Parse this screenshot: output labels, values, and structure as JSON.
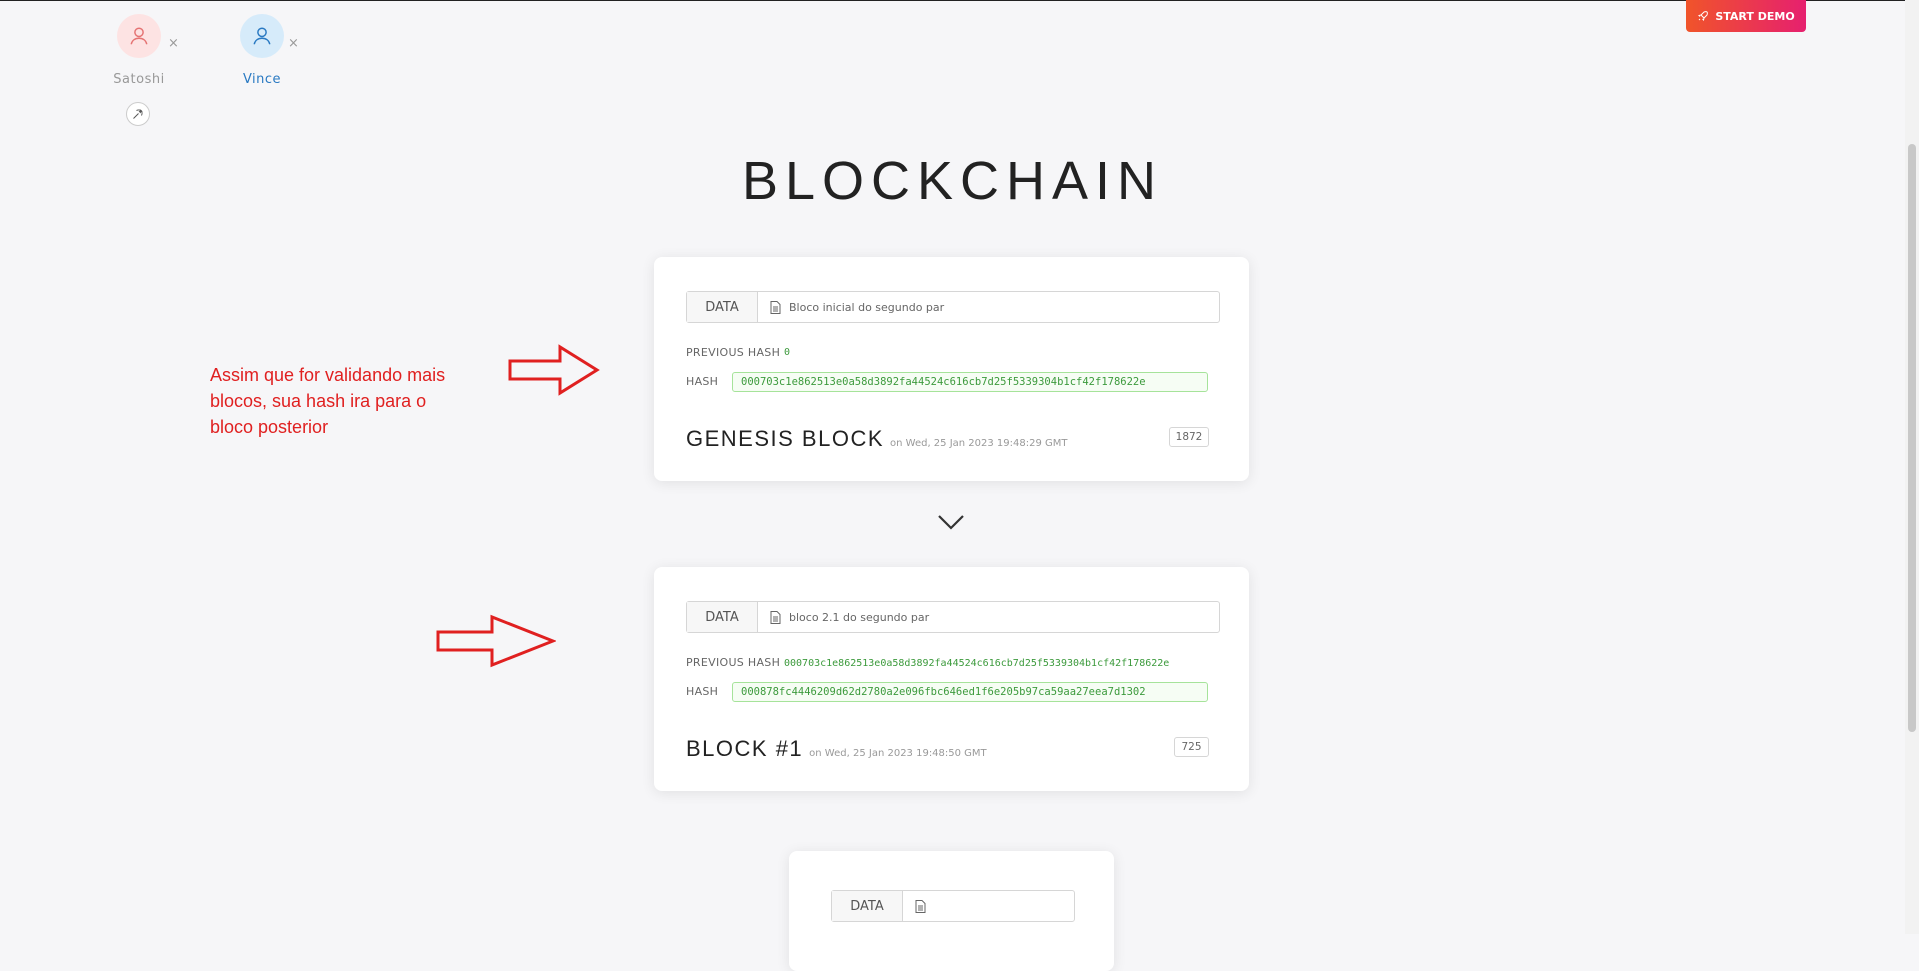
{
  "users": [
    {
      "name": "Satoshi",
      "avatar_icon": "user-icon",
      "color": "#e57373",
      "remove": "×"
    },
    {
      "name": "Vince",
      "avatar_icon": "user-icon",
      "color": "#2979c2",
      "remove": "×"
    }
  ],
  "demo_button": {
    "label": "START DEMO",
    "icon": "rocket-icon"
  },
  "page_title": "BLOCKCHAIN",
  "annotation": "Assim que for validando mais blocos, sua hash ira para o bloco posterior",
  "labels": {
    "data": "DATA",
    "previous_hash": "PREVIOUS HASH",
    "hash": "HASH"
  },
  "blocks": [
    {
      "data": "Bloco inicial do segundo par",
      "previous_hash": "0",
      "hash": "000703c1e862513e0a58d3892fa44524c616cb7d25f5339304b1cf42f178622e",
      "title": "GENESIS BLOCK",
      "timestamp": "on Wed, 25 Jan 2023 19:48:29 GMT",
      "nonce": "1872"
    },
    {
      "data": "bloco 2.1 do segundo par",
      "previous_hash": "000703c1e862513e0a58d3892fa44524c616cb7d25f5339304b1cf42f178622e",
      "hash": "000878fc4446209d62d2780a2e096fbc646ed1f6e205b97ca59aa27eea7d1302",
      "title": "BLOCK #1",
      "timestamp": "on Wed, 25 Jan 2023 19:48:50 GMT",
      "nonce": "725"
    },
    {
      "data": ""
    }
  ],
  "colors": {
    "accent_red": "#e02020",
    "hash_green": "#3c9a3c",
    "demo_gradient_start": "#f0542a",
    "demo_gradient_end": "#e6206f"
  }
}
